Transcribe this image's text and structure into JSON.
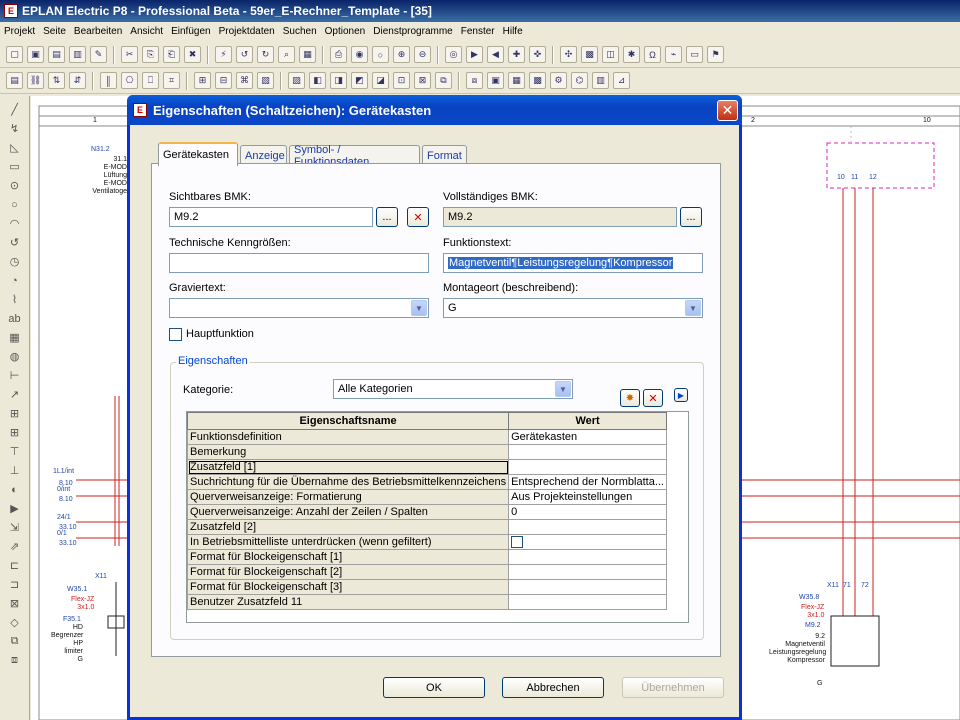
{
  "app": {
    "title": "EPLAN Electric P8 - Professional Beta - 59er_E-Rechner_Template - [35]",
    "logo_letters": "E"
  },
  "menu": [
    "Projekt",
    "Seite",
    "Bearbeiten",
    "Ansicht",
    "Einfügen",
    "Projektdaten",
    "Suchen",
    "Optionen",
    "Dienstprogramme",
    "Fenster",
    "Hilfe"
  ],
  "canvas": {
    "labels_left": [
      {
        "text": "N31.2",
        "cls": ""
      },
      {
        "text": "31.1\nE-MOD\nLüftung\nE-MOD\nVentilatoge",
        "cls": "black"
      },
      {
        "text": "1L1/int",
        "cls": ""
      },
      {
        "text": "8.10",
        "cls": "small"
      },
      {
        "text": "0/int",
        "cls": ""
      },
      {
        "text": "8.10",
        "cls": "small"
      },
      {
        "text": "24/1",
        "cls": ""
      },
      {
        "text": "33.10",
        "cls": "small"
      },
      {
        "text": "0/1",
        "cls": ""
      },
      {
        "text": "33.10",
        "cls": "small"
      },
      {
        "text": "X11",
        "cls": ""
      },
      {
        "text": "W35.1",
        "cls": ""
      },
      {
        "text": "Flex-JZ\n3x1.0",
        "cls": "small"
      },
      {
        "text": "F35.1",
        "cls": ""
      },
      {
        "text": "HD\nBegrenzer\nHP\nlimiter\nG",
        "cls": "black"
      }
    ],
    "labels_right": {
      "x11": "X11",
      "w35_8": "W35.8",
      "w35_8_sub": "Flex-JZ\n3x1.0",
      "m9_2": "M9.2",
      "m9_2_sub": "9.2\nMagnetventil\nLeistungsregelung\nKompressor",
      "g": "G",
      "pins_top": [
        "10",
        "11",
        "12"
      ],
      "terminals": [
        "71",
        "72"
      ]
    },
    "ruler": [
      "1",
      "2",
      "10"
    ]
  },
  "dialog": {
    "title": "Eigenschaften (Schaltzeichen): Gerätekasten",
    "tabs": [
      "Gerätekasten",
      "Anzeige",
      "Symbol- / Funktionsdaten",
      "Format"
    ],
    "sichtbares_bmk": {
      "label": "Sichtbares BMK:",
      "value": "M9.2"
    },
    "vollstaendiges_bmk": {
      "label": "Vollständiges BMK:",
      "value": "M9.2"
    },
    "technische_kenngroessen": {
      "label": "Technische Kenngrößen:",
      "value": ""
    },
    "funktionstext": {
      "label": "Funktionstext:",
      "value": "Magnetventil¶Leistungsregelung¶Kompressor"
    },
    "graviertext": {
      "label": "Graviertext:",
      "value": ""
    },
    "montageort": {
      "label": "Montageort (beschreibend):",
      "value": "G"
    },
    "hauptfunktion_label": "Hauptfunktion",
    "eigenschaften_group": "Eigenschaften",
    "kategorie": {
      "label": "Kategorie:",
      "value": "Alle Kategorien"
    },
    "grid_headers": [
      "Eigenschaftsname",
      "Wert"
    ],
    "grid_rows": [
      {
        "name": "Funktionsdefinition",
        "value": "Gerätekasten"
      },
      {
        "name": "Bemerkung",
        "value": ""
      },
      {
        "name": "Zusatzfeld [1]",
        "value": ""
      },
      {
        "name": "Suchrichtung für die Übernahme des Betriebsmittelkennzeichens",
        "value": "Entsprechend der Normblatta..."
      },
      {
        "name": "Querverweisanzeige: Formatierung",
        "value": "Aus Projekteinstellungen"
      },
      {
        "name": "Querverweisanzeige: Anzahl der Zeilen / Spalten",
        "value": "0"
      },
      {
        "name": "Zusatzfeld [2]",
        "value": ""
      },
      {
        "name": "In Betriebsmittelliste unterdrücken (wenn gefiltert)",
        "value": ""
      },
      {
        "name": "Format für Blockeigenschaft [1]",
        "value": ""
      },
      {
        "name": "Format für Blockeigenschaft [2]",
        "value": ""
      },
      {
        "name": "Format für Blockeigenschaft [3]",
        "value": ""
      },
      {
        "name": "Benutzer Zusatzfeld 11",
        "value": ""
      }
    ],
    "buttons": {
      "ok": "OK",
      "cancel": "Abbrechen",
      "apply": "Übernehmen"
    },
    "ellipsis": "..."
  }
}
